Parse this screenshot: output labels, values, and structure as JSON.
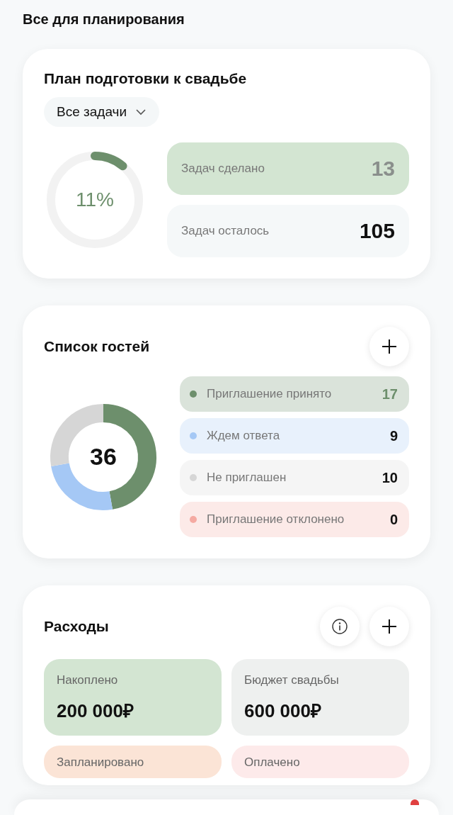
{
  "header": {
    "title": "Все для планирования"
  },
  "plan": {
    "title": "План подготовки к свадьбе",
    "filter": "Все задачи",
    "progress": {
      "label": "11%",
      "level": 0.11
    },
    "stats": [
      {
        "label": "Задач сделано",
        "value": "13",
        "kind": "done"
      },
      {
        "label": "Задач осталось",
        "value": "105",
        "kind": "left"
      }
    ]
  },
  "guests": {
    "title": "Список гостей",
    "total": "36",
    "statuses": [
      {
        "label": "Приглашение принято",
        "count": "17",
        "color": "#6d8f6c"
      },
      {
        "label": "Ждем ответа",
        "count": "9",
        "color": "#a5c8f5"
      },
      {
        "label": "Не приглашен",
        "count": "10",
        "color": "#d6d6d6"
      },
      {
        "label": "Приглашение отклонено",
        "count": "0",
        "color": "#f5aaa2"
      }
    ]
  },
  "expenses": {
    "title": "Расходы",
    "tiles": [
      {
        "label": "Накоплено",
        "value": "200 000₽",
        "color": "#d3e5d2"
      },
      {
        "label": "Бюджет свадьбы",
        "value": "600 000₽",
        "color": "#eef0ef"
      },
      {
        "label": "Запланировано",
        "color": "#fbe4d6"
      },
      {
        "label": "Оплачено",
        "color": "#fdeaea"
      }
    ]
  }
}
